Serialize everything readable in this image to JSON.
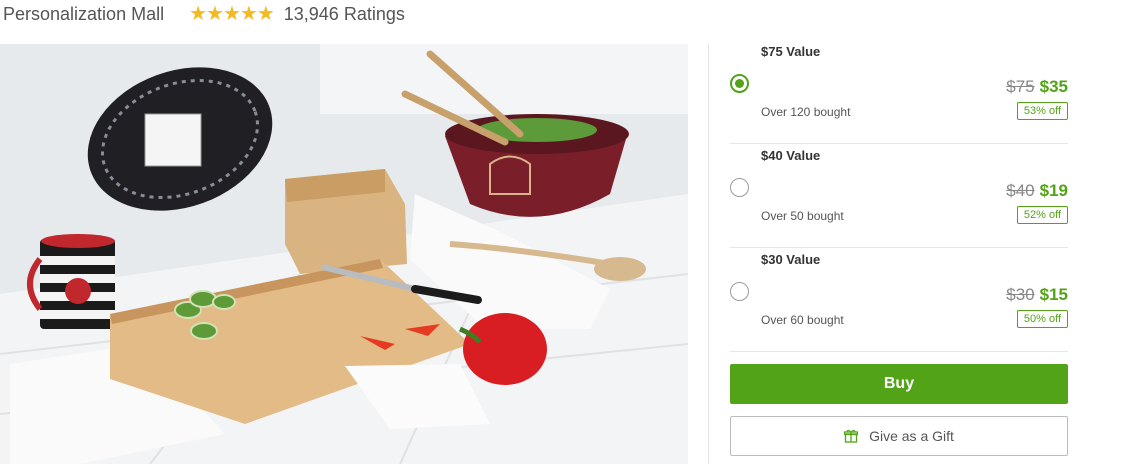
{
  "header": {
    "merchant": "Personalization Mall",
    "rating_stars": 5,
    "ratings_text": "13,946 Ratings"
  },
  "image": {
    "description_icon": "product-photo"
  },
  "options": [
    {
      "title": "$75 Value",
      "original": "$75",
      "price": "$35",
      "discount": "53% off",
      "bought": "Over 120 bought",
      "selected": true
    },
    {
      "title": "$40 Value",
      "original": "$40",
      "price": "$19",
      "discount": "52% off",
      "bought": "Over 50 bought",
      "selected": false
    },
    {
      "title": "$30 Value",
      "original": "$30",
      "price": "$15",
      "discount": "50% off",
      "bought": "Over 60 bought",
      "selected": false
    }
  ],
  "actions": {
    "buy_label": "Buy",
    "gift_label": "Give as a Gift"
  },
  "colors": {
    "accent": "#53a318",
    "star": "#f5b922"
  }
}
